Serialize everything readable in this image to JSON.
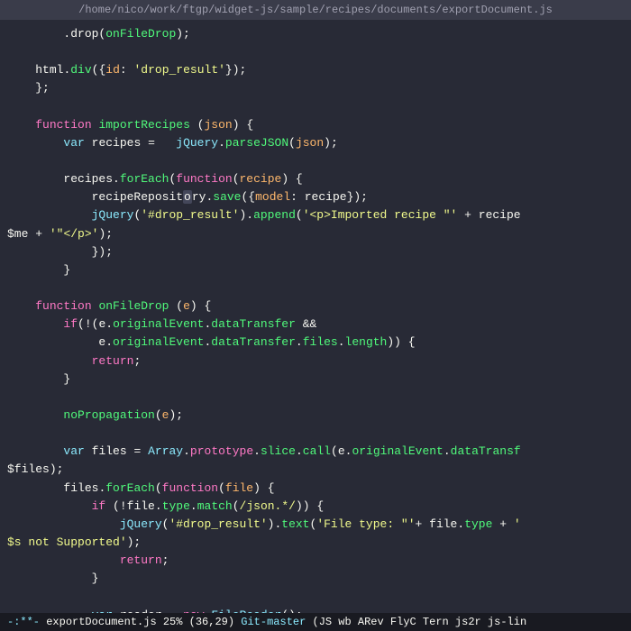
{
  "titleBar": {
    "path": "/home/nico/work/ftgp/widget-js/sample/recipes/documents/exportDocument.js"
  },
  "statusBar": {
    "mode": "-:**-",
    "filename": "exportDocument.js",
    "percent": "25%",
    "position": "(36,29)",
    "branch": "Git-master",
    "flags": "(JS wb ARev FlyC Tern js2r js-lin"
  },
  "code": [
    "        .drop(onFileDrop);",
    "",
    "    html.div({id: 'drop_result'});",
    "    };",
    "",
    "    function importRecipes (json) {",
    "        var recipes =   jQuery.parseJSON(json);",
    "",
    "        recipes.forEach(function(recipe) {",
    "            recipeRepository.save({model: recipe});",
    "            jQuery('#drop_result').append('<p>Imported recipe \"' + recipe",
    "$me + '\"</p>');",
    "            });",
    "        }",
    "",
    "    function onFileDrop (e) {",
    "        if(!(e.originalEvent.dataTransfer &&",
    "             e.originalEvent.dataTransfer.files.length)) {",
    "            return;",
    "        }",
    "",
    "        noPropagation(e);",
    "",
    "        var files = Array.prototype.slice.call(e.originalEvent.dataTransf",
    "$files);",
    "        files.forEach(function(file) {",
    "            if (!file.type.match(/json.*/)) {",
    "                jQuery('#drop_result').text('File type: \"'+ file.type + '",
    "$s not Supported');",
    "                return;",
    "            }",
    "",
    "            var reader = new FileReader();"
  ]
}
